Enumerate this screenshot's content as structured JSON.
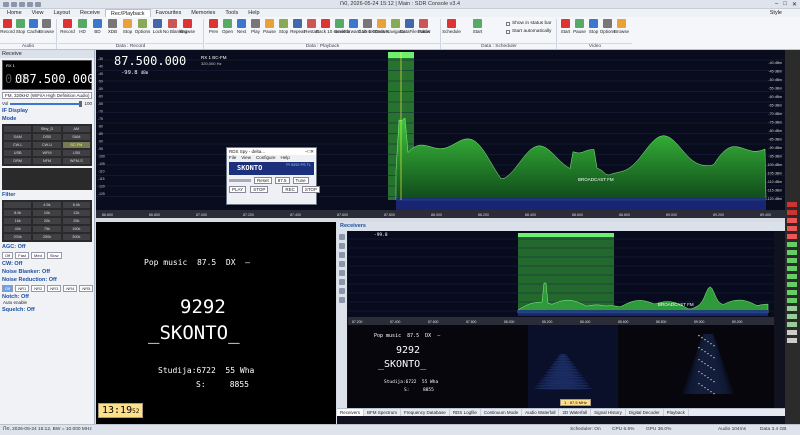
{
  "window": {
    "title": "Ռ0, 2026-05-24 15:12 | Main : SDR Console v3.4"
  },
  "menu": {
    "items": [
      "Home",
      "View",
      "Layout",
      "Receive",
      "Rec/Playback",
      "Favourites",
      "Memories",
      "Tools",
      "Help"
    ],
    "active": "Rec/Playback",
    "style_label": "Style"
  },
  "ribbon": {
    "audio_buttons": [
      "Record",
      "Stop",
      "Cache",
      "Browse"
    ],
    "audio_group": "Audio",
    "data_record_buttons": [
      "Record",
      "HD",
      "BD",
      "XDB",
      "Stop",
      "Options",
      "Lock",
      "No Blanking",
      "Browse"
    ],
    "data_record_group": "Data : Record",
    "playback_buttons": [
      "Prev",
      "Open",
      "Next",
      "Play",
      "Pause",
      "Stop",
      "Repeat",
      "Restart",
      "Back 10 seconds",
      "Seek",
      "Forward 10 seconds",
      "Gain 0.00",
      "Center",
      "Navigator",
      "DataFile Folder",
      "Status"
    ],
    "playback_group": "Data : Playback",
    "scheduler_buttons": [
      "Schedule",
      "Start"
    ],
    "scheduler_checks": [
      "Show in status bar",
      "Start automatically"
    ],
    "scheduler_group": "Data : Scheduler",
    "video_buttons": [
      "Start",
      "Pause",
      "Stop",
      "Options",
      "Browse"
    ],
    "video_group": "Video"
  },
  "left_panel": {
    "header": "Receive",
    "vfo_label": "RX 1",
    "vfo_freq": "087.500.000",
    "vfo_ghost": "0.0",
    "mode_select": "FM, 320kHz (WiFi/A High Definition Audio)",
    "volume_label": "Vol",
    "volume_value": "100",
    "if_display_label": "IF Display",
    "mode_label": "Mode",
    "mode_buttons": [
      "",
      "Stby_D",
      "AM",
      "SAM",
      "DSB",
      "SAM",
      "CW-L",
      "CW-U",
      "SC-FM",
      "USB",
      "WFM",
      "LSB",
      "DRM",
      "NFM",
      "WFM-S"
    ],
    "mode_active": "SC-FM",
    "filter_label": "Filter",
    "filter_buttons": [
      "",
      "4.5k",
      "6.0k",
      "8.0k",
      "10k",
      "12k",
      "16k",
      "20k",
      "25k",
      "40k",
      "75k",
      "150k",
      "200k",
      "250k",
      "300k"
    ],
    "agc_label": "AGC: Off",
    "agc_buttons": [
      "Off",
      "Fast",
      "Med",
      "Slow"
    ],
    "cw_label": "CW: Off",
    "noise_blanker_label": "Noise Blanker: Off",
    "noise_reduction_label": "Noise Reduction: Off",
    "nr_buttons": [
      "Off",
      "NR1",
      "NR2",
      "NR3",
      "NR4",
      "NR5"
    ],
    "notch_label": "Notch: Off",
    "auto_enable_label": "Auto enable",
    "squelch_label": "Squelch: Off"
  },
  "main_spectrum": {
    "frequency": "87.500.000",
    "rx_label": "RX 1   BC-FM",
    "bw_label": "320,000 Hz",
    "level": "-99.8",
    "level_unit": "dBm",
    "station_label": "BROADCAST FM",
    "db_scale": [
      "-40 dBm",
      "-45 dBm",
      "-50 dBm",
      "-55 dBm",
      "-60 dBm",
      "-65 dBm",
      "-70 dBm",
      "-75 dBm",
      "-80 dBm",
      "-85 dBm",
      "-90 dBm",
      "-95 dBm",
      "-100 dBm",
      "-105 dBm",
      "-110 dBm",
      "-115 dBm",
      "-120 dBm"
    ],
    "left_scale": [
      "-35",
      "-40",
      "-45",
      "-50",
      "-55",
      "-60",
      "-65",
      "-70",
      "-75",
      "-80",
      "-85",
      "-90",
      "-95",
      "-100",
      "-105",
      "-110",
      "-115",
      "-120",
      "-125"
    ],
    "freq_scale": [
      "86.600",
      "86.800",
      "87.000",
      "87.200",
      "87.400",
      "87.600",
      "87.800",
      "88.000",
      "88.200",
      "88.400",
      "88.600",
      "88.800",
      "89.000",
      "89.200",
      "89.400"
    ]
  },
  "rds_dialog": {
    "title": "RDS Spy - delta...",
    "menu": [
      "File",
      "View",
      "Configure",
      "Help"
    ],
    "ps": "SKONTO",
    "pi": "PI 9292  PS TL",
    "reset_label": "Reset",
    "select_value": "87.5",
    "tune_label": "Tune",
    "play_label": "PLAY",
    "stop_label": "STOP",
    "rec_label": "REC",
    "stop2_label": "STOP"
  },
  "rds_display": {
    "line1": "Pop music  87.5  DX  –",
    "pi_code": "9292",
    "ps_name": "_SKONTO_",
    "radiotext1": "Studija:6722  55 Wha",
    "radiotext2": "S:     8855",
    "clock": "13:19",
    "clock_sec": "52"
  },
  "receivers": {
    "header": "Receivers",
    "level": "-99.8",
    "station_label": "BROADCAST FM",
    "rx_tag": "1 · 87.5 MHz",
    "rds_line1": "Pop music  87.5  DX  –",
    "pi_code": "9292",
    "ps_name": "_SKONTO_",
    "radiotext1": "Studija:6722  55 Wha",
    "radiotext2": "S:     8855",
    "freq_scale": [
      "87.200",
      "87.400",
      "87.600",
      "87.800",
      "88.000",
      "88.200",
      "88.400",
      "88.600",
      "88.800",
      "89.000",
      "89.200"
    ]
  },
  "tabs": [
    "Receivers",
    "BFM Spectrum",
    "Frequency Database",
    "RDS Logfile",
    "Continuum Mode",
    "Audio Waterfall",
    "2D Waterfall",
    "Signal History",
    "Digital Decoder",
    "Playback"
  ],
  "tab_active": "Receivers",
  "status": {
    "left": "Ռ0, 2026-05-24 15:12, BW = 10.000 MHz",
    "scheduler": "Scheduler: On",
    "cpu": "CPU 6.5%",
    "gpu": "GPU 36.0%",
    "audio": "Audio 104ms",
    "mem": "Data 3.4 GB"
  },
  "colors": {
    "spectrum_green": "#3ec63e",
    "spectrum_bg": "#090c1c",
    "accent_blue": "#1a4fa0",
    "clock_bg": "#ffe08a"
  }
}
